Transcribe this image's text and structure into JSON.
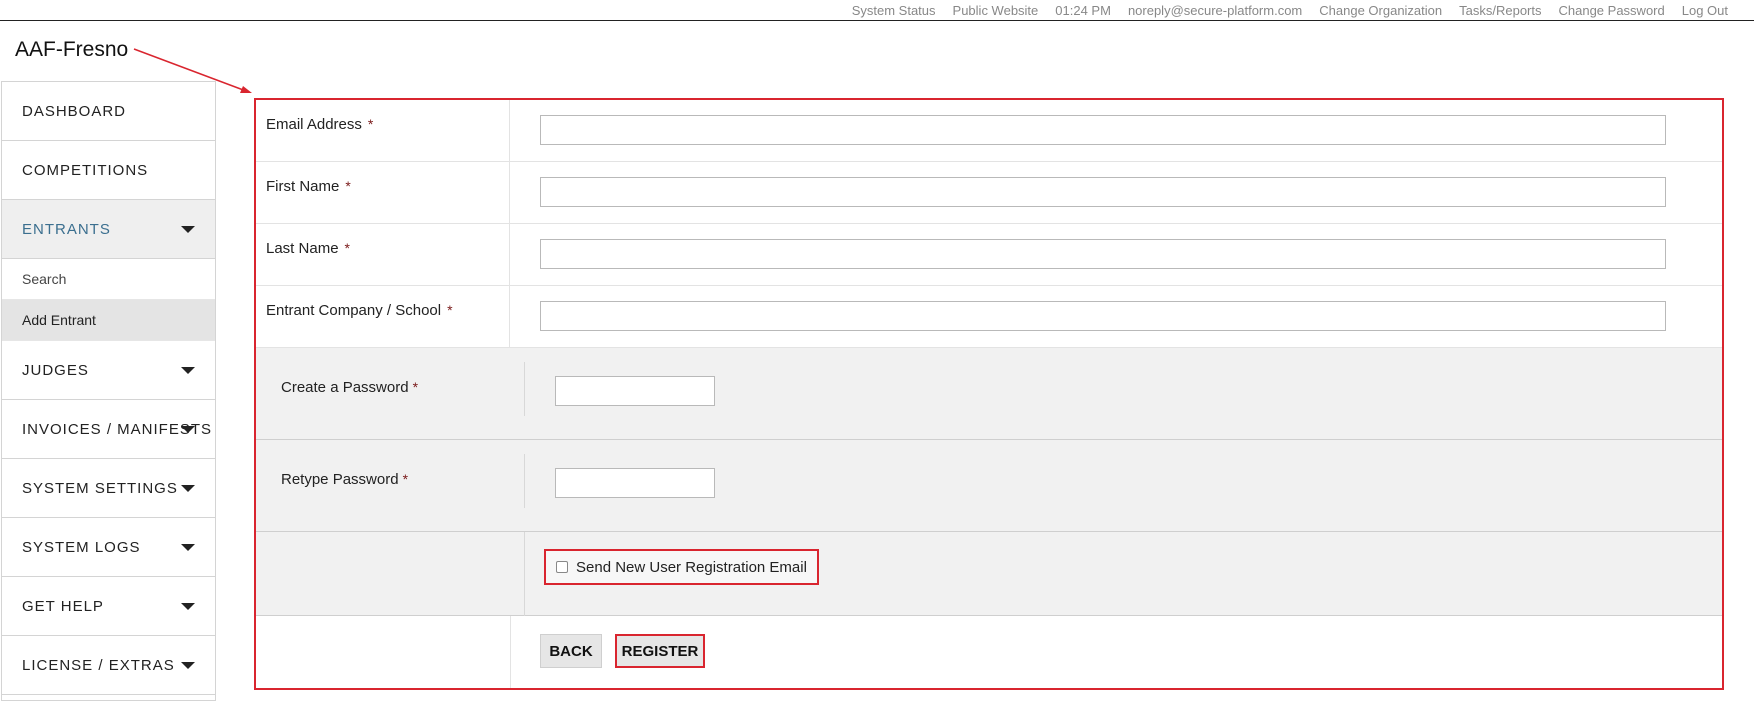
{
  "topbar": {
    "links": [
      {
        "label": "System Status"
      },
      {
        "label": "Public Website"
      },
      {
        "label": "01:24 PM"
      },
      {
        "label": "noreply@secure-platform.com"
      },
      {
        "label": "Change Organization"
      },
      {
        "label": "Tasks/Reports"
      },
      {
        "label": "Change Password"
      },
      {
        "label": "Log Out"
      }
    ]
  },
  "org": {
    "title": "AAF-Fresno"
  },
  "sidebar": {
    "items": [
      {
        "label": "DASHBOARD"
      },
      {
        "label": "COMPETITIONS"
      },
      {
        "label": "ENTRANTS"
      },
      {
        "label": "JUDGES"
      },
      {
        "label": "INVOICES / MANIFESTS"
      },
      {
        "label": "SYSTEM SETTINGS"
      },
      {
        "label": "SYSTEM LOGS"
      },
      {
        "label": "GET HELP"
      },
      {
        "label": "LICENSE / EXTRAS"
      }
    ],
    "entrants_sub": [
      {
        "label": "Search"
      },
      {
        "label": "Add Entrant"
      }
    ]
  },
  "form": {
    "required_mark": "*",
    "email_label": "Email Address",
    "email_value": "",
    "first_name_label": "First Name",
    "first_name_value": "",
    "last_name_label": "Last Name",
    "last_name_value": "",
    "company_label": "Entrant Company / School",
    "company_value": "",
    "create_password_label": "Create a Password",
    "retype_password_label": "Retype Password",
    "send_email_label": "Send New User Registration Email",
    "send_email_checked": false,
    "back_label": "BACK",
    "register_label": "REGISTER"
  },
  "colors": {
    "annotation": "#d9252f",
    "active_nav_text": "#3b6f8f",
    "required": "#7a1a1a"
  }
}
